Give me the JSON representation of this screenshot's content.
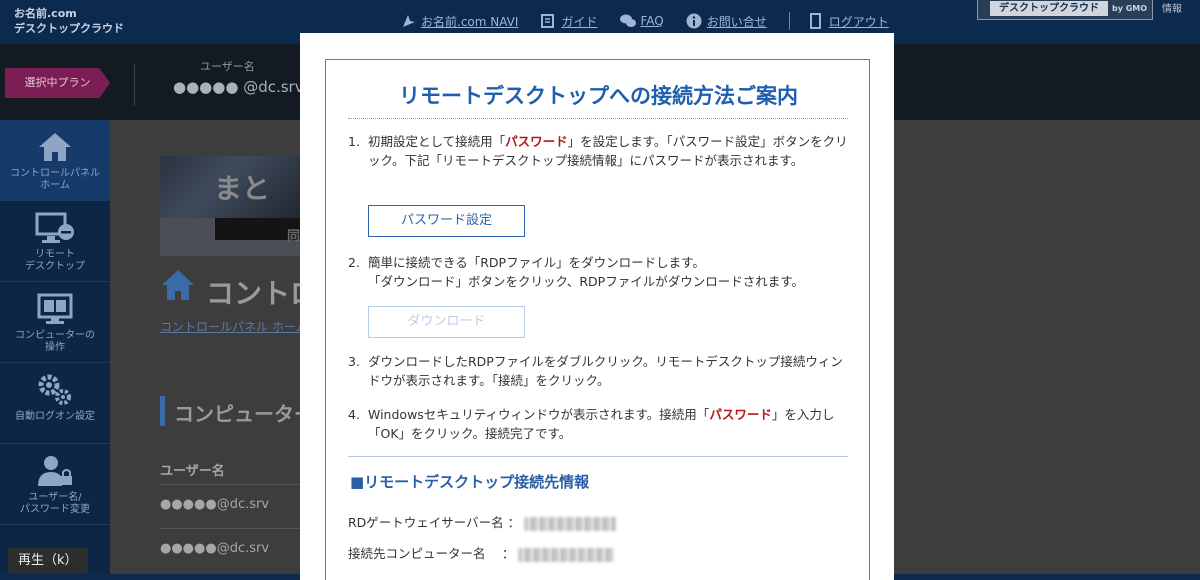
{
  "header": {
    "logo_line1": "お名前.com",
    "logo_line2": "デスクトップクラウド",
    "nav": [
      {
        "label": "お名前.com NAVI",
        "icon": "navi-icon"
      },
      {
        "label": "ガイド",
        "icon": "guide-book-icon"
      },
      {
        "label": "FAQ",
        "icon": "faq-chat-icon"
      },
      {
        "label": "お問い合せ",
        "icon": "info-icon"
      }
    ],
    "logout_label": "ログアウト",
    "brand_label": "デスクトップクラウド",
    "brand_sub": "by GMO",
    "right_fragment": "情報"
  },
  "userbar": {
    "plan_label": "選択中プラン",
    "user_label": "ユーザー名",
    "user_name": "●●●●● @dc.srv"
  },
  "sidebar": {
    "items": [
      {
        "label": "コントロールパネル\nホーム",
        "icon": "home-icon",
        "active": true
      },
      {
        "label": "リモート\nデスクトップ",
        "icon": "remote-desktop-icon",
        "active": false
      },
      {
        "label": "コンピューターの\n操作",
        "icon": "computer-icon",
        "active": false
      },
      {
        "label": "自動ログオン設定",
        "icon": "gears-icon",
        "active": false
      },
      {
        "label": "ユーザー名/\nパスワード変更",
        "icon": "user-lock-icon",
        "active": false
      }
    ]
  },
  "main": {
    "banner_text": "まと",
    "banner_sub": "同",
    "page_title": "コントロ",
    "breadcrumb": "コントロールパネル ホーム",
    "section_title": "コンピューター",
    "column_header": "ユーザー名",
    "rows": [
      "●●●●●@dc.srv",
      "●●●●●@dc.srv"
    ]
  },
  "modal": {
    "title": "リモートデスクトップへの接続方法ご案内",
    "step1_num": "1.",
    "step1_pre": "初期設定として接続用「",
    "step1_red": "パスワード",
    "step1_post": "」を設定します。「パスワード設定」ボタンをクリック。下記「リモートデスクトップ接続情報」にパスワードが表示されます。",
    "password_button": "パスワード設定",
    "step2_num": "2.",
    "step2_line1": "簡単に接続できる「RDPファイル」をダウンロードします。",
    "step2_line2": "「ダウンロード」ボタンをクリック、RDPファイルがダウンロードされます。",
    "download_button": "ダウンロード",
    "step3_num": "3.",
    "step3_text": "ダウンロードしたRDPファイルをダブルクリック。リモートデスクトップ接続ウィンドウが表示されます。「接続」をクリック。",
    "step4_num": "4.",
    "step4_pre": "Windowsセキュリティウィンドウが表示されます。接続用「",
    "step4_red": "パスワード",
    "step4_post": "」を入力し「OK」をクリック。接続完了です。",
    "info_heading": "■リモートデスクトップ接続先情報",
    "info_rows": [
      {
        "label": "RDゲートウェイサーバー名 ："
      },
      {
        "label": "接続先コンピューター名　 ："
      }
    ]
  },
  "player": {
    "play_label": "再生（k）"
  },
  "colors": {
    "header_bg": "#0c2a4d",
    "accent_blue": "#1f5fae",
    "password_red": "#b61616",
    "plan_badge": "#7a1d52"
  }
}
